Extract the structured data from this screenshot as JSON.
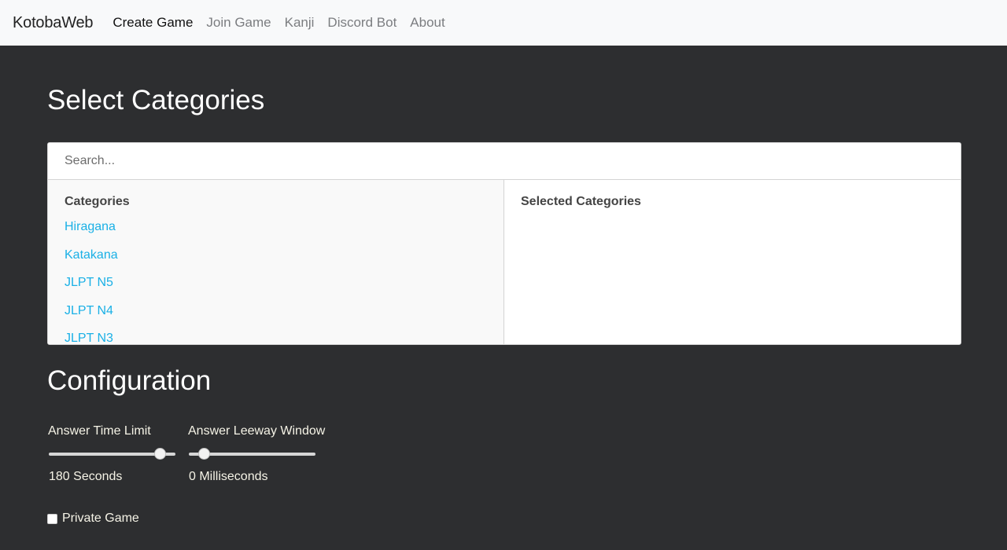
{
  "nav": {
    "brand": "KotobaWeb",
    "links": [
      {
        "label": "Create Game",
        "active": true
      },
      {
        "label": "Join Game",
        "active": false
      },
      {
        "label": "Kanji",
        "active": false
      },
      {
        "label": "Discord Bot",
        "active": false
      },
      {
        "label": "About",
        "active": false
      }
    ]
  },
  "categories_section": {
    "title": "Select Categories",
    "search_placeholder": "Search...",
    "left_header": "Categories",
    "right_header": "Selected Categories",
    "items": [
      "Hiragana",
      "Katakana",
      "JLPT N5",
      "JLPT N4",
      "JLPT N3"
    ],
    "selected_items": []
  },
  "config_section": {
    "title": "Configuration",
    "answer_time_limit": {
      "label": "Answer Time Limit",
      "value_text": "180 Seconds",
      "fraction": 0.88
    },
    "answer_leeway_window": {
      "label": "Answer Leeway Window",
      "value_text": "0 Milliseconds",
      "fraction": 0.13
    },
    "private_game": {
      "label": "Private Game",
      "checked": false
    }
  },
  "colors": {
    "background": "#2d2e30",
    "link": "#1ab0e6",
    "config_text": "#f5f3e6"
  }
}
